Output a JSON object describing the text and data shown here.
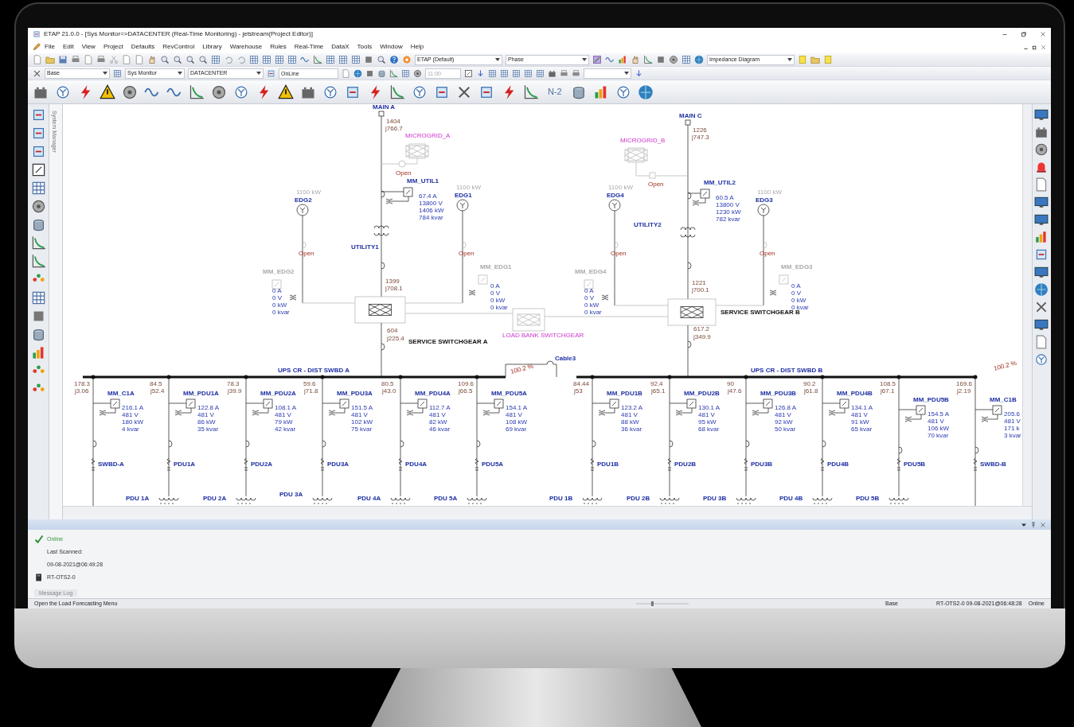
{
  "window": {
    "title": "ETAP 21.0.0 - [Sys Monitor=>DATACENTER (Real-Time Monitoring) - jetstream(Project Editor)]"
  },
  "menu": [
    "File",
    "Edit",
    "View",
    "Project",
    "Defaults",
    "RevControl",
    "Library",
    "Warehouse",
    "Rules",
    "Real-Time",
    "DataX",
    "Tools",
    "Window",
    "Help"
  ],
  "toolbar_1": {
    "theme_dropdown": "ETAP (Default)",
    "display_dropdown": "Phase",
    "presentation_dropdown": "Impedance Diagram"
  },
  "toolbar_2": {
    "config_dropdown": "Base",
    "mode_dropdown": "Sys Monitor",
    "study_dropdown": "DATACENTER",
    "status_field": "OnLine",
    "time_field": "11:00"
  },
  "toolbar_3": {
    "text_button": "N-2"
  },
  "side_panel": {
    "title": "System Manager"
  },
  "diagram": {
    "mains": [
      {
        "name": "MAIN A",
        "flow": [
          "1404",
          "j766.7"
        ]
      },
      {
        "name": "MAIN C",
        "flow": [
          "1226",
          "j747.3"
        ]
      }
    ],
    "microgrids": [
      {
        "name": "MICROGRID_A",
        "switch": "Open"
      },
      {
        "name": "MICROGRID_B",
        "switch": "Open"
      }
    ],
    "utility_meters": [
      {
        "name": "MM_UTIL1",
        "readings": [
          "67.4 A",
          "13800 V",
          "1406 kW",
          "784 kvar"
        ]
      },
      {
        "name": "MM_UTIL2",
        "readings": [
          "60.5 A",
          "13800 V",
          "1230 kW",
          "782 kvar"
        ]
      }
    ],
    "transformers": [
      "UTILITY1",
      "UTILITY2"
    ],
    "generators": [
      {
        "name": "EDG2",
        "rating": "1100 kW",
        "switch": "Open",
        "meter": "MM_EDG2",
        "readings": [
          "0 A",
          "0 V",
          "0 kW",
          "0 kvar"
        ]
      },
      {
        "name": "EDG1",
        "rating": "1100 kW",
        "switch": "Open",
        "meter": "MM_EDG1",
        "readings": [
          "0 A",
          "0 V",
          "0 kW",
          "0 kvar"
        ]
      },
      {
        "name": "EDG4",
        "rating": "1100 kW",
        "switch": "Open",
        "meter": "MM_EDG4",
        "readings": [
          "0 A",
          "0 V",
          "0 kW",
          "0 kvar"
        ]
      },
      {
        "name": "EDG3",
        "rating": "1100 kW",
        "switch": "Open",
        "meter": "MM_EDG3",
        "readings": [
          "0 A",
          "0 V",
          "0 kW",
          "0 kvar"
        ]
      }
    ],
    "switchgears": [
      {
        "name": "SERVICE SWITCHGEAR A",
        "in_flow": [
          "1399",
          "j708.1"
        ],
        "out_flow": [
          "604",
          "j225.4"
        ]
      },
      {
        "name": "SERVICE SWITCHGEAR B",
        "in_flow": [
          "1221",
          "j700.1"
        ],
        "out_flow": [
          "617.2",
          "j349.9"
        ]
      }
    ],
    "load_bank": "LOAD BANK SWITCHGEAR",
    "tie_cable": {
      "name": "Cable3",
      "loading": "100.2 %"
    },
    "end_loading": "100.2 %",
    "buses": [
      {
        "name": "UPS CR - DIST SWBD A",
        "feeders": [
          {
            "flow": [
              "178.3",
              "j3.06"
            ],
            "meter": "MM_C1A",
            "readings": [
              "216.1 A",
              "481 V",
              "180 kW",
              "4 kvar"
            ],
            "cable": "SWBD-A"
          },
          {
            "flow": [
              "84.5",
              "j52.4"
            ],
            "meter": "MM_PDU1A",
            "readings": [
              "122.8 A",
              "481 V",
              "86 kW",
              "35 kvar"
            ],
            "cable": "PDU1A",
            "load": "PDU 1A"
          },
          {
            "flow": [
              "78.3",
              "j39.9"
            ],
            "meter": "MM_PDU2A",
            "readings": [
              "108.1 A",
              "481 V",
              "79 kW",
              "42 kvar"
            ],
            "cable": "PDU2A",
            "load": "PDU 2A"
          },
          {
            "flow": [
              "59.6",
              "j71.8"
            ],
            "meter": "MM_PDU3A",
            "readings": [
              "151.5 A",
              "481 V",
              "102 kW",
              "75 kvar"
            ],
            "cable": "PDU3A",
            "load": "PDU 3A"
          },
          {
            "flow": [
              "80.5",
              "j43.0"
            ],
            "meter": "MM_PDU4A",
            "readings": [
              "112.7 A",
              "481 V",
              "82 kW",
              "46 kvar"
            ],
            "cable": "PDU4A",
            "load": "PDU 4A"
          },
          {
            "flow": [
              "109.6",
              "j66.5"
            ],
            "meter": "MM_PDU5A",
            "readings": [
              "154.1 A",
              "481 V",
              "108 kW",
              "69 kvar"
            ],
            "cable": "PDU5A",
            "load": "PDU 5A"
          }
        ]
      },
      {
        "name": "UPS CR - DIST SWBD B",
        "feeders": [
          {
            "flow": [
              "84.44",
              "j53"
            ],
            "meter": "MM_PDU1B",
            "readings": [
              "123.2 A",
              "481 V",
              "88 kW",
              "36 kvar"
            ],
            "cable": "PDU1B",
            "load": "PDU 1B"
          },
          {
            "flow": [
              "92.4",
              "j65.1"
            ],
            "meter": "MM_PDU2B",
            "readings": [
              "130.1 A",
              "481 V",
              "95 kW",
              "68 kvar"
            ],
            "cable": "PDU2B",
            "load": "PDU 2B"
          },
          {
            "flow": [
              "90",
              "j47.6"
            ],
            "meter": "MM_PDU3B",
            "readings": [
              "126.8 A",
              "481 V",
              "92 kW",
              "50 kvar"
            ],
            "cable": "PDU3B",
            "load": "PDU 3B"
          },
          {
            "flow": [
              "90.2",
              "j61.8"
            ],
            "meter": "MM_PDU4B",
            "readings": [
              "134.1 A",
              "481 V",
              "91 kW",
              "65 kvar"
            ],
            "cable": "PDU4B",
            "load": "PDU 4B"
          },
          {
            "flow": [
              "108.5",
              "j67.1"
            ],
            "meter": "MM_PDU5B",
            "readings": [
              "154.5 A",
              "481 V",
              "106 kW",
              "70 kvar"
            ],
            "cable": "PDU5B",
            "load": "PDU 5B"
          },
          {
            "flow": [
              "169.6",
              "j2.19"
            ],
            "meter": "MM_C1B",
            "readings": [
              "205.6",
              "481 V",
              "171 k",
              "3 kvar"
            ],
            "cable": "SWBD-B"
          }
        ]
      }
    ]
  },
  "message_log": {
    "status": "Online",
    "scan_label": "Last Scanned:",
    "scan_time": "09-08-2021@06:49:28",
    "server": "RT-OTS2-0",
    "tab": "Message Log"
  },
  "status_bar": {
    "hint": "Open the Load Forecasting Menu",
    "zoom_slider": {
      "level": 0.3
    },
    "config": "Base",
    "connection": "RT-OTS2-0 09-08-2021@06:48:28",
    "state": "Online"
  }
}
